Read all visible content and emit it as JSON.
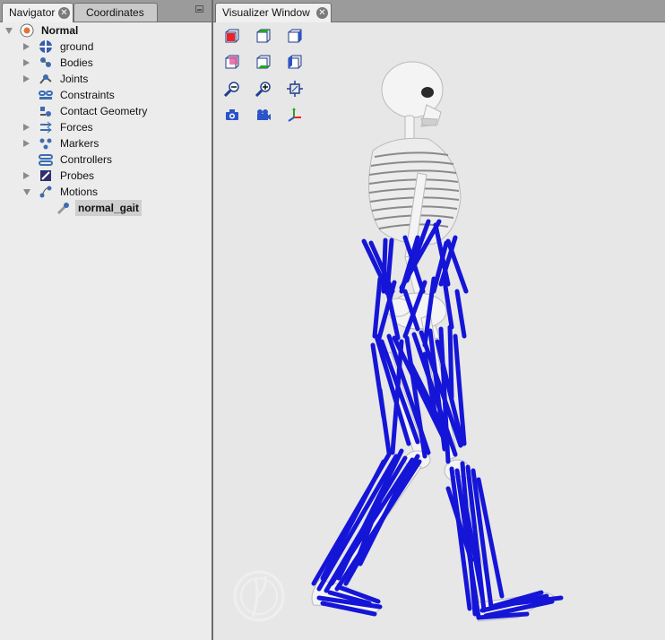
{
  "navigator": {
    "tabs": [
      {
        "label": "Navigator",
        "active": true
      },
      {
        "label": "Coordinates",
        "active": false
      }
    ],
    "tree": [
      {
        "label": "Normal",
        "icon": "model-icon",
        "state": "expanded",
        "bold": true
      },
      {
        "label": "ground",
        "icon": "ground-icon",
        "state": "collapsed"
      },
      {
        "label": "Bodies",
        "icon": "bodies-icon",
        "state": "collapsed"
      },
      {
        "label": "Joints",
        "icon": "joints-icon",
        "state": "collapsed"
      },
      {
        "label": "Constraints",
        "icon": "constraints-icon",
        "state": "leaf"
      },
      {
        "label": "Contact Geometry",
        "icon": "contact-geometry-icon",
        "state": "leaf"
      },
      {
        "label": "Forces",
        "icon": "forces-icon",
        "state": "collapsed"
      },
      {
        "label": "Markers",
        "icon": "markers-icon",
        "state": "collapsed"
      },
      {
        "label": "Controllers",
        "icon": "controllers-icon",
        "state": "leaf"
      },
      {
        "label": "Probes",
        "icon": "probes-icon",
        "state": "collapsed"
      },
      {
        "label": "Motions",
        "icon": "motions-icon",
        "state": "expanded"
      },
      {
        "label": "normal_gait",
        "icon": "motion-icon",
        "state": "leaf",
        "selected": true
      }
    ]
  },
  "visualizer": {
    "tab_label": "Visualizer Window",
    "toolbar": [
      "front-view-icon",
      "top-view-icon",
      "right-view-icon",
      "back-view-icon",
      "bottom-view-icon",
      "left-view-icon",
      "zoom-out-icon",
      "zoom-in-icon",
      "fit-to-screen-icon",
      "snapshot-camera-icon",
      "record-movie-icon",
      "toggle-axes-icon"
    ],
    "muscle_color": "#1515d8",
    "bone_color": "#f4f4f4"
  }
}
